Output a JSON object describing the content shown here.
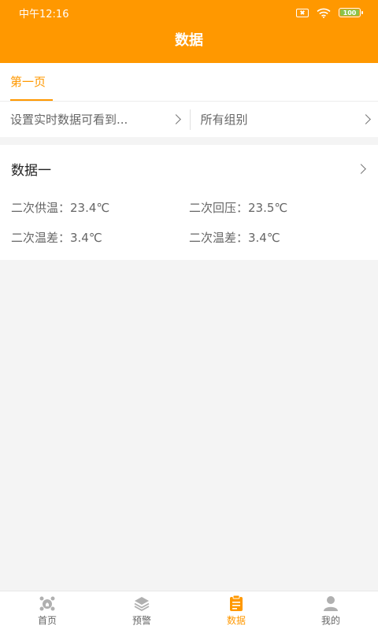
{
  "status_bar": {
    "time": "中午12:16",
    "battery": "100"
  },
  "header": {
    "title": "数据"
  },
  "tabs": [
    {
      "label": "第一页",
      "active": true
    }
  ],
  "filters": {
    "left_label": "设置实时数据可看到...",
    "right_label": "所有组别"
  },
  "card": {
    "title": "数据一",
    "rows": [
      [
        "二次供温：23.4℃",
        "二次回压：23.5℃"
      ],
      [
        "二次温差：3.4℃",
        "二次温差：3.4℃"
      ]
    ]
  },
  "bottom_nav": {
    "items": [
      {
        "label": "首页",
        "icon": "home-network-icon"
      },
      {
        "label": "预警",
        "icon": "layers-icon"
      },
      {
        "label": "数据",
        "icon": "clipboard-icon",
        "active": true
      },
      {
        "label": "我的",
        "icon": "person-icon"
      }
    ]
  },
  "colors": {
    "accent": "#ff9800",
    "inactive_icon": "#b0b0b0"
  }
}
